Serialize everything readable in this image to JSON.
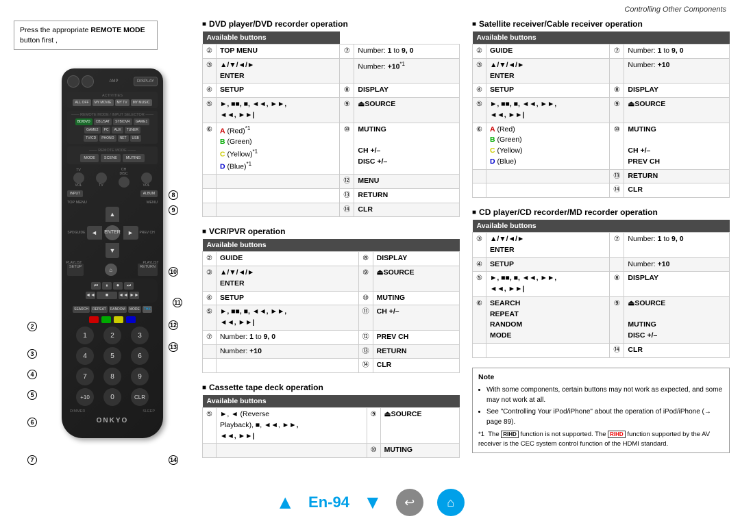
{
  "header": {
    "title": "Controlling Other Components"
  },
  "note_box": {
    "line1": "Press the appropriate ",
    "bold": "REMOTE MODE",
    "line2": " button first ,"
  },
  "callouts": [
    "②",
    "③",
    "④",
    "⑤",
    "⑥",
    "⑦",
    "⑧",
    "⑨",
    "⑩",
    "⑪",
    "⑫",
    "⑬",
    "⑭"
  ],
  "sections": {
    "dvd": {
      "title": "DVD player/DVD recorder operation",
      "available_buttons": "Available buttons",
      "left_col": [
        {
          "num": "②",
          "label": "TOP MENU"
        },
        {
          "num": "③",
          "label": "▲/▼/◄/►",
          "sub": "ENTER"
        },
        {
          "num": "④",
          "label": "SETUP"
        },
        {
          "num": "⑤",
          "label": "►, ■■, ■, ◄◄, ►►",
          "sub": "◄◄, ►►|"
        },
        {
          "num": "⑥",
          "label": "A (Red)",
          "sup": "*1",
          "extras": [
            "B (Green)",
            "C (Yellow)*1",
            "D (Blue)*1"
          ]
        }
      ],
      "right_col": [
        {
          "num": "⑦",
          "label": "Number: 1 to 9, 0"
        },
        {
          "num": "",
          "label": "Number: +10",
          "sup": "*1"
        },
        {
          "num": "⑧",
          "label": "DISPLAY"
        },
        {
          "num": "⑨",
          "label": "⏏SOURCE"
        },
        {
          "num": "⑩",
          "label": "MUTING"
        },
        {
          "num": "⑪",
          "label": "CH +/–"
        },
        {
          "num": "",
          "label": "DISC +/–"
        },
        {
          "num": "⑫",
          "label": "MENU"
        },
        {
          "num": "⑬",
          "label": "RETURN"
        },
        {
          "num": "⑭",
          "label": "CLR"
        }
      ]
    },
    "vcr": {
      "title": "VCR/PVR operation",
      "available_buttons": "Available buttons",
      "left_col": [
        {
          "num": "②",
          "label": "GUIDE"
        },
        {
          "num": "③",
          "label": "▲/▼/◄/►",
          "sub": "ENTER"
        },
        {
          "num": "④",
          "label": "SETUP"
        },
        {
          "num": "⑤",
          "label": "►, ■■, ■, ◄◄, ►►",
          "sub": "◄◄, ►►|"
        }
      ],
      "right_col": [
        {
          "num": "⑧",
          "label": "DISPLAY"
        },
        {
          "num": "⑨",
          "label": "⏏SOURCE"
        },
        {
          "num": "⑩",
          "label": "MUTING"
        },
        {
          "num": "⑪",
          "label": "CH +/–"
        },
        {
          "num": "⑫",
          "label": "PREV CH"
        },
        {
          "num": "⑬",
          "label": "RETURN"
        },
        {
          "num": "⑦",
          "label": "Number: 1 to 9, 0"
        },
        {
          "num": "",
          "label": "Number: +10"
        },
        {
          "num": "⑭",
          "label": "CLR"
        }
      ]
    },
    "cassette": {
      "title": "Cassette tape deck operation",
      "available_buttons": "Available buttons",
      "left_col": [
        {
          "num": "⑤",
          "label": "►, ◄ (Reverse",
          "sub": "Playback), ■, ◄◄, ►►,",
          "sub2": "◄◄, ►►|"
        }
      ],
      "right_col": [
        {
          "num": "⑨",
          "label": "⏏SOURCE"
        },
        {
          "num": "⑩",
          "label": "MUTING"
        }
      ]
    },
    "satellite": {
      "title": "Satellite receiver/Cable receiver operation",
      "available_buttons": "Available buttons",
      "left_col": [
        {
          "num": "②",
          "label": "GUIDE"
        },
        {
          "num": "③",
          "label": "▲/▼/◄/►",
          "sub": "ENTER"
        },
        {
          "num": "④",
          "label": "SETUP"
        },
        {
          "num": "⑤",
          "label": "►, ■■, ■, ◄◄, ►►",
          "sub": "◄◄, ►►|"
        },
        {
          "num": "⑥",
          "label": "A (Red)",
          "extras": [
            "B (Green)",
            "C (Yellow)",
            "D (Blue)"
          ]
        }
      ],
      "right_col": [
        {
          "num": "⑦",
          "label": "Number: 1 to 9, 0"
        },
        {
          "num": "",
          "label": "Number: +10"
        },
        {
          "num": "⑧",
          "label": "DISPLAY"
        },
        {
          "num": "⑨",
          "label": "⏏SOURCE"
        },
        {
          "num": "⑩",
          "label": "MUTING"
        },
        {
          "num": "⑪",
          "label": "CH +/–"
        },
        {
          "num": "⑫",
          "label": "PREV CH"
        },
        {
          "num": "⑬",
          "label": "RETURN"
        },
        {
          "num": "⑭",
          "label": "CLR"
        }
      ]
    },
    "cd": {
      "title": "CD player/CD recorder/MD recorder operation",
      "available_buttons": "Available buttons",
      "left_col": [
        {
          "num": "③",
          "label": "▲/▼/◄/►",
          "sub": "ENTER"
        },
        {
          "num": "④",
          "label": "SETUP"
        },
        {
          "num": "⑤",
          "label": "►, ■■, ■, ◄◄, ►►",
          "sub": "◄◄, ►►|"
        },
        {
          "num": "⑥",
          "label": "SEARCH",
          "extras": [
            "REPEAT",
            "RANDOM",
            "MODE"
          ]
        }
      ],
      "right_col": [
        {
          "num": "⑦",
          "label": "Number: 1 to 9, 0"
        },
        {
          "num": "",
          "label": "Number: +10"
        },
        {
          "num": "⑧",
          "label": "DISPLAY"
        },
        {
          "num": "⑨",
          "label": "⏏SOURCE"
        },
        {
          "num": "⑩",
          "label": "MUTING"
        },
        {
          "num": "⑪",
          "label": "DISC +/–"
        },
        {
          "num": "⑭",
          "label": "CLR"
        }
      ]
    }
  },
  "notes": {
    "title": "Note",
    "items": [
      "With some components, certain buttons may not work as expected, and some may not work at all.",
      "See \"Controlling Your iPod/iPhone\" about the operation of iPod/iPhone (→ page 89)."
    ],
    "footnote": "*1  The  function is not supported. The       function supported by the AV receiver is the CEC system control function of the HDMI standard."
  },
  "footer": {
    "prev_arrow": "▲",
    "page_label": "En-94",
    "next_arrow": "▼"
  },
  "remote": {
    "brand": "ONKYO",
    "callout_numbers": {
      "c8": "8",
      "c9": "9",
      "c10": "10",
      "c11": "11",
      "c2": "2",
      "c12": "12",
      "c3": "3",
      "c13": "13",
      "c4": "4",
      "c5": "5",
      "c6": "6",
      "c7": "7",
      "c14": "14"
    }
  }
}
